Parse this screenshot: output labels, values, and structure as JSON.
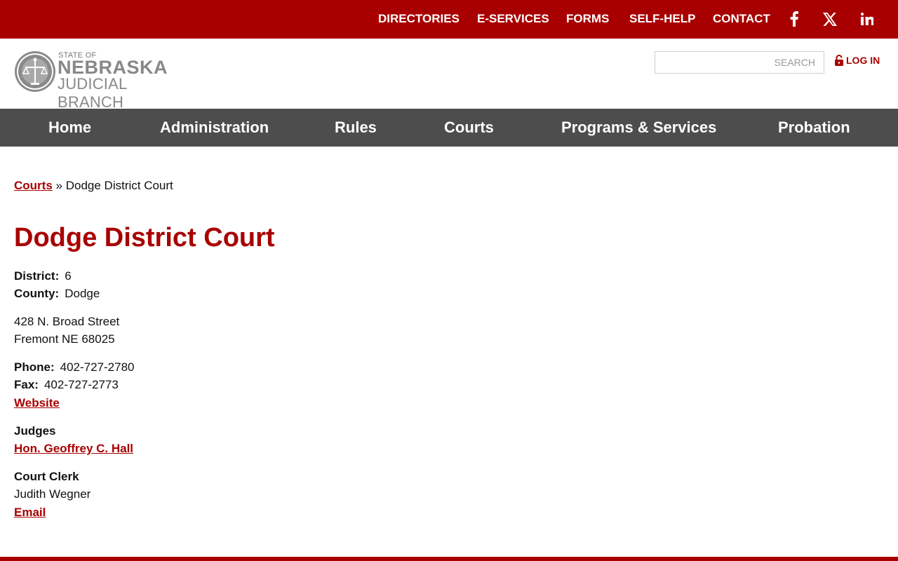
{
  "top_nav": {
    "links": [
      "DIRECTORIES",
      "E-SERVICES",
      "FORMS",
      "SELF-HELP",
      "CONTACT"
    ],
    "social": [
      "facebook-icon",
      "x-icon",
      "linkedin-icon"
    ]
  },
  "logo": {
    "state_of": "STATE OF",
    "name": "NEBRASKA",
    "branch": "JUDICIAL BRANCH"
  },
  "search": {
    "placeholder": "SEARCH"
  },
  "login": {
    "label": "LOG IN"
  },
  "main_nav": [
    "Home",
    "Administration",
    "Rules",
    "Courts",
    "Programs & Services",
    "Probation"
  ],
  "breadcrumb": {
    "parent": "Courts",
    "separator": "»",
    "current": "Dodge District Court"
  },
  "page": {
    "title": "Dodge District Court",
    "district_label": "District:",
    "district_value": "6",
    "county_label": "County:",
    "county_value": "Dodge",
    "address_line1": "428 N. Broad Street",
    "address_line2": "Fremont NE 68025",
    "phone_label": "Phone:",
    "phone_value": "402-727-2780",
    "fax_label": "Fax:",
    "fax_value": "402-727-2773",
    "website_link": "Website",
    "judges_heading": "Judges",
    "judge_name": "Hon. Geoffrey C. Hall",
    "clerk_heading": "Court Clerk",
    "clerk_name": "Judith Wegner",
    "email_link": "Email"
  },
  "colors": {
    "brand_red": "#a80000",
    "nav_gray": "#4d4d4d"
  }
}
